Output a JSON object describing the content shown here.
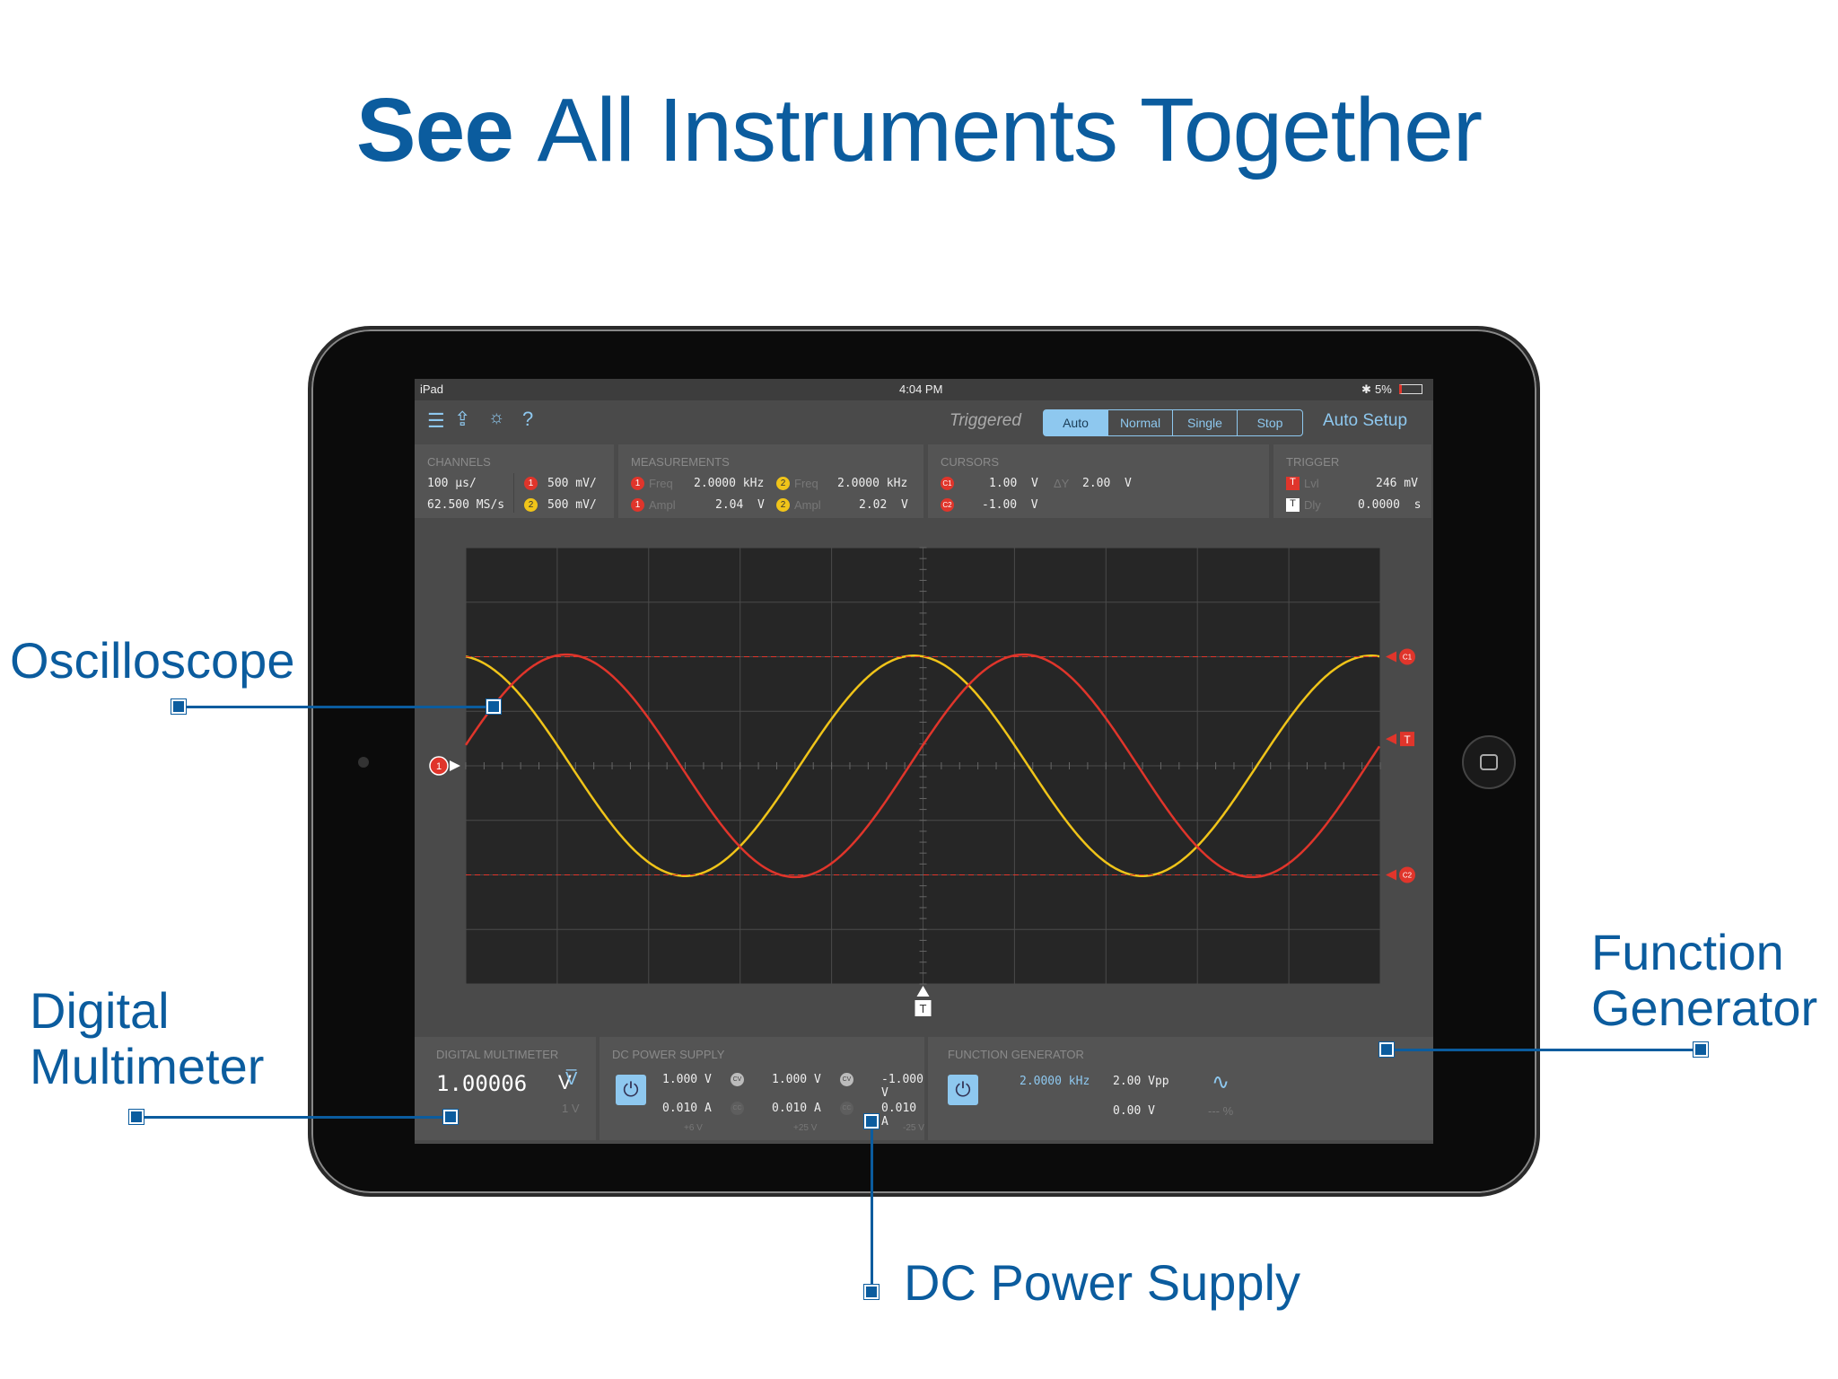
{
  "headline": {
    "bold": "See",
    "rest": "All Instruments Together"
  },
  "callouts": {
    "oscilloscope": "Oscilloscope",
    "dmm_line1": "Digital",
    "dmm_line2": "Multimeter",
    "fg_line1": "Function",
    "fg_line2": "Generator",
    "dc": "DC Power Supply"
  },
  "status": {
    "device": "iPad",
    "time": "4:04 PM",
    "battery": "5%",
    "bluetooth_icon": "bluetooth-icon"
  },
  "toolbar": {
    "state": "Triggered",
    "modes": [
      "Auto",
      "Normal",
      "Single",
      "Stop"
    ],
    "active_mode": "Auto",
    "auto_setup": "Auto Setup"
  },
  "channels": {
    "title": "CHANNELS",
    "timebase": "100 µs/",
    "sample_rate": "62.500 MS/s",
    "ch1_scale": "500 mV/",
    "ch2_scale": "500 mV/",
    "ch1": "1",
    "ch2": "2"
  },
  "measurements": {
    "title": "MEASUREMENTS",
    "freq_label": "Freq",
    "ampl_label": "Ampl",
    "ch1_freq": "2.0000 kHz",
    "ch2_freq": "2.0000 kHz",
    "ch1_ampl": "2.04  V",
    "ch2_ampl": "2.02  V"
  },
  "cursors": {
    "title": "CURSORS",
    "c1_label": "C1",
    "c2_label": "C2",
    "c1": "1.00  V",
    "c2": "-1.00  V",
    "dy_label": "ΔY",
    "dy": "2.00  V"
  },
  "trigger": {
    "title": "TRIGGER",
    "lvl_label": "Lvl",
    "dly_label": "Dly",
    "lvl": "246 mV",
    "dly": "0.0000  s",
    "t": "T"
  },
  "scope": {
    "ch1_color": "#e0352b",
    "ch2_color": "#f0c419",
    "frequency_khz": 2.0,
    "ch1_amplitude_v": 1.02,
    "ch2_amplitude_v": 1.01,
    "cursor_c1_v": 1.0,
    "cursor_c2_v": -1.0,
    "trigger_level_mv": 246,
    "volts_per_div": 0.5,
    "us_per_div": 100
  },
  "dmm": {
    "title": "DIGITAL MULTIMETER",
    "value": "1.00006",
    "unit": "V",
    "mode_icon": "V̅",
    "range": "1 V"
  },
  "dc": {
    "title": "DC POWER SUPPLY",
    "ch": [
      {
        "v": "1.000 V",
        "a": "0.010 A",
        "rail": "+6 V"
      },
      {
        "v": "1.000 V",
        "a": "0.010 A",
        "rail": "+25 V"
      },
      {
        "v": "-1.000 V",
        "a": "0.010 A",
        "rail": "-25 V"
      }
    ],
    "cv": "CV",
    "cc": "CC"
  },
  "fg": {
    "title": "FUNCTION GENERATOR",
    "freq": "2.0000 kHz",
    "ampl": "2.00 Vpp",
    "offset": "0.00 V",
    "duty": "--- %",
    "wave_icon": "∿"
  },
  "colors": {
    "brand": "#0b5c9e",
    "accent": "#8ec8ef"
  }
}
